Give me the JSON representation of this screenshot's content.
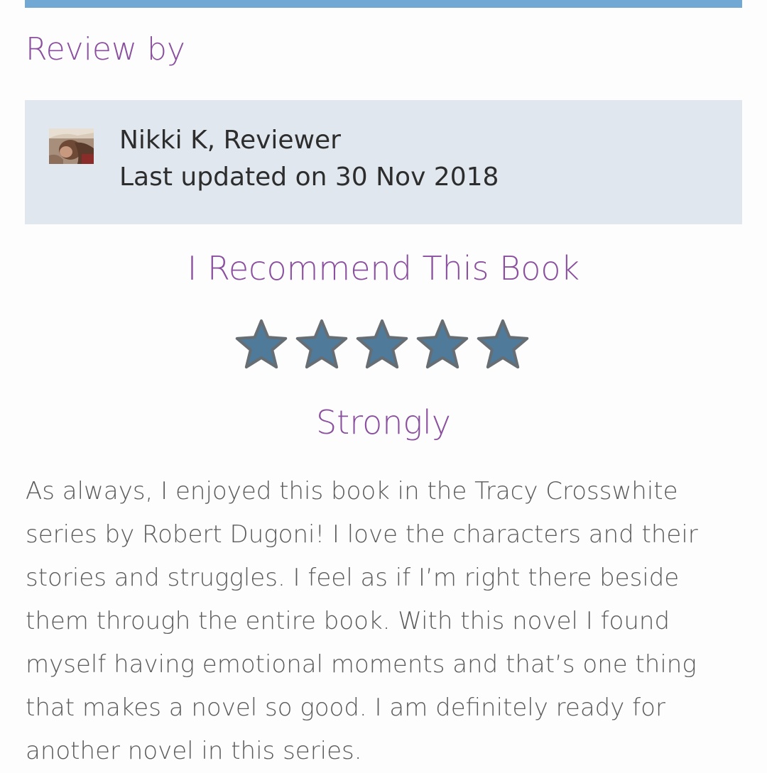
{
  "review": {
    "heading": "Review by",
    "reviewer": {
      "name_line": "Nikki K, Reviewer",
      "date_line": "Last updated on 30 Nov 2018",
      "avatar_icon": "reviewer-photo"
    },
    "recommendation": "I Recommend This Book",
    "rating": {
      "stars": 5,
      "max": 5,
      "star_color": "#4f7a99",
      "star_outline": "#666d73"
    },
    "strength": "Strongly",
    "body": "As always, I enjoyed this book in the Tracy Crosswhite series by Robert Dugoni! I love the characters and their stories and struggles. I feel as if I’m right there beside them through the entire book. With this novel I found myself having emotional moments and that’s one thing that makes a novel so good. I am definitely ready for another novel in this series."
  },
  "colors": {
    "accent_bar": "#72a8d4",
    "heading": "#8a4f9e",
    "card_background": "#e0e7ef",
    "body_text": "#5b5b5b"
  }
}
